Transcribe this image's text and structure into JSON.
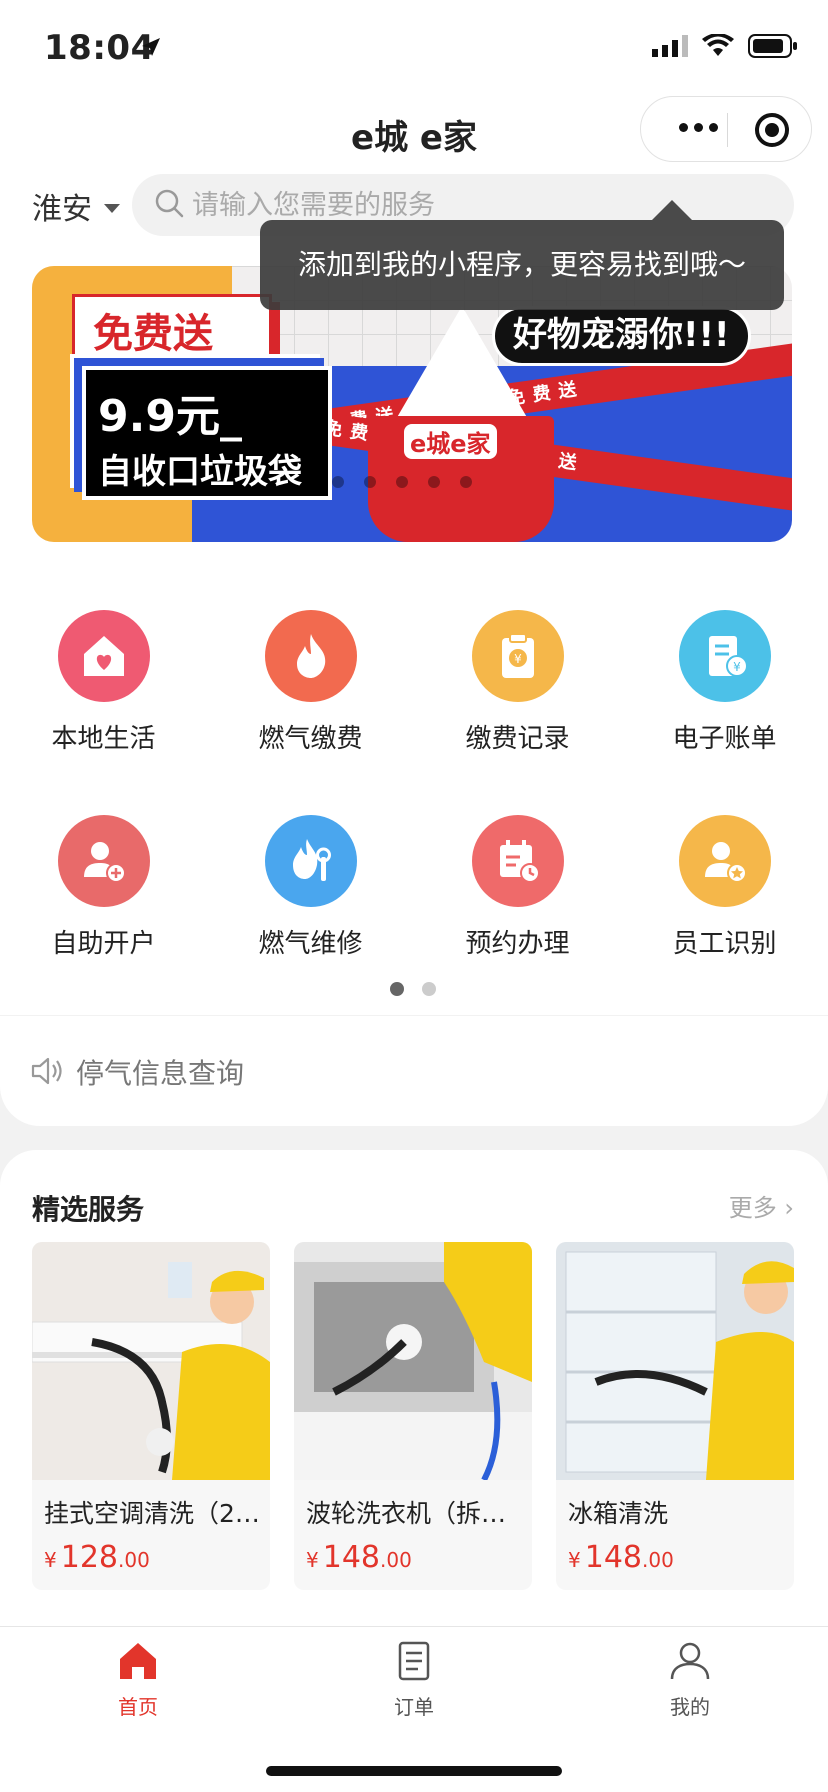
{
  "status_bar": {
    "time": "18:04"
  },
  "nav": {
    "title": "e城 e家"
  },
  "search": {
    "city": "淮安",
    "placeholder": "请输入您需要的服务"
  },
  "tooltip": {
    "text": "添加到我的小程序，更容易找到哦～"
  },
  "banner": {
    "free_label": "免费送",
    "price_line1": "9.9元_",
    "price_line2": "自收口垃圾袋",
    "slogan": "好物宠溺你!!!",
    "logo": "e城e家",
    "stripe_text": "免费送 免费送 免费送"
  },
  "services": [
    {
      "label": "本地生活",
      "icon": "house-heart-icon",
      "color": "#ef5a72"
    },
    {
      "label": "燃气缴费",
      "icon": "flame-icon",
      "color": "#f26a4f"
    },
    {
      "label": "缴费记录",
      "icon": "clipboard-yen-icon",
      "color": "#f5b74a"
    },
    {
      "label": "电子账单",
      "icon": "receipt-icon",
      "color": "#4cc1e8"
    },
    {
      "label": "自助开户",
      "icon": "user-add-icon",
      "color": "#e86a6a"
    },
    {
      "label": "燃气维修",
      "icon": "flame-wrench-icon",
      "color": "#4aa6ee"
    },
    {
      "label": "预约办理",
      "icon": "calendar-clock-icon",
      "color": "#ef6a6a"
    },
    {
      "label": "员工识别",
      "icon": "user-star-icon",
      "color": "#f5b74a"
    }
  ],
  "notice": {
    "text": "停气信息查询",
    "icon": "speaker-icon"
  },
  "featured": {
    "title": "精选服务",
    "more": "更多",
    "items": [
      {
        "name": "挂式空调清洗（2…",
        "currency": "¥",
        "price_int": "128",
        "price_dec": ".00"
      },
      {
        "name": "波轮洗衣机（拆洗）",
        "currency": "¥",
        "price_int": "148",
        "price_dec": ".00"
      },
      {
        "name": "冰箱清洗",
        "currency": "¥",
        "price_int": "148",
        "price_dec": ".00"
      }
    ]
  },
  "tabbar": {
    "items": [
      {
        "label": "首页",
        "icon": "home-icon"
      },
      {
        "label": "订单",
        "icon": "order-list-icon"
      },
      {
        "label": "我的",
        "icon": "user-icon"
      }
    ]
  },
  "colors": {
    "accent": "#e2352b"
  }
}
